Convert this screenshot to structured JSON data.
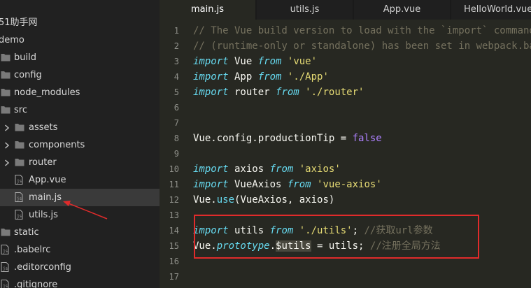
{
  "sidebar": {
    "project": "51助手网",
    "root": "demo",
    "items": [
      {
        "label": "build",
        "type": "folder",
        "expanded": false
      },
      {
        "label": "config",
        "type": "folder",
        "expanded": false
      },
      {
        "label": "node_modules",
        "type": "folder",
        "expanded": false
      },
      {
        "label": "src",
        "type": "folder",
        "expanded": true
      },
      {
        "label": "assets",
        "type": "folder",
        "expanded": false
      },
      {
        "label": "components",
        "type": "folder",
        "expanded": false
      },
      {
        "label": "router",
        "type": "folder",
        "expanded": false
      },
      {
        "label": "App.vue",
        "type": "file"
      },
      {
        "label": "main.js",
        "type": "file",
        "selected": true
      },
      {
        "label": "utils.js",
        "type": "file"
      },
      {
        "label": "static",
        "type": "folder",
        "expanded": false
      },
      {
        "label": ".babelrc",
        "type": "file"
      },
      {
        "label": ".editorconfig",
        "type": "file"
      },
      {
        "label": ".gitignore",
        "type": "file"
      }
    ]
  },
  "tabs": [
    {
      "label": "main.js",
      "active": true
    },
    {
      "label": "utils.js",
      "active": false
    },
    {
      "label": "App.vue",
      "active": false
    },
    {
      "label": "HelloWorld.vue",
      "active": false
    }
  ],
  "editor": {
    "line_numbers": [
      "1",
      "2",
      "3",
      "4",
      "5",
      "6",
      "7",
      "8",
      "9",
      "10",
      "11",
      "12",
      "13",
      "14",
      "15",
      "16",
      "17"
    ],
    "lines": [
      [
        {
          "t": "// The Vue build version to load with the `import` command",
          "c": "cm"
        }
      ],
      [
        {
          "t": "// (runtime-only or standalone) has been set in webpack.base.conf",
          "c": "cm"
        }
      ],
      [
        {
          "t": "import",
          "c": "kw"
        },
        {
          "t": " Vue "
        },
        {
          "t": "from",
          "c": "kw"
        },
        {
          "t": " "
        },
        {
          "t": "'vue'",
          "c": "str"
        }
      ],
      [
        {
          "t": "import",
          "c": "kw"
        },
        {
          "t": " App "
        },
        {
          "t": "from",
          "c": "kw"
        },
        {
          "t": " "
        },
        {
          "t": "'./App'",
          "c": "str"
        }
      ],
      [
        {
          "t": "import",
          "c": "kw"
        },
        {
          "t": " router "
        },
        {
          "t": "from",
          "c": "kw"
        },
        {
          "t": " "
        },
        {
          "t": "'./router'",
          "c": "str"
        }
      ],
      [],
      [],
      [
        {
          "t": "Vue.config.productionTip = "
        },
        {
          "t": "false",
          "c": "bool"
        }
      ],
      [],
      [
        {
          "t": "import",
          "c": "kw"
        },
        {
          "t": " axios "
        },
        {
          "t": "from",
          "c": "kw"
        },
        {
          "t": " "
        },
        {
          "t": "'axios'",
          "c": "str"
        }
      ],
      [
        {
          "t": "import",
          "c": "kw"
        },
        {
          "t": " VueAxios "
        },
        {
          "t": "from",
          "c": "kw"
        },
        {
          "t": " "
        },
        {
          "t": "'vue-axios'",
          "c": "str"
        }
      ],
      [
        {
          "t": "Vue."
        },
        {
          "t": "use",
          "c": "fn"
        },
        {
          "t": "(VueAxios, axios)"
        }
      ],
      [],
      [
        {
          "t": "import",
          "c": "kw"
        },
        {
          "t": " utils "
        },
        {
          "t": "from",
          "c": "kw"
        },
        {
          "t": " "
        },
        {
          "t": "'./utils'",
          "c": "str"
        },
        {
          "t": "; "
        },
        {
          "t": "//获取url参数",
          "c": "cm"
        }
      ],
      [
        {
          "t": "Vue."
        },
        {
          "t": "prototype",
          "c": "it"
        },
        {
          "t": "."
        },
        {
          "t": "$utils",
          "c": "hl"
        },
        {
          "t": " = utils; "
        },
        {
          "t": "//注册全局方法",
          "c": "cm"
        }
      ],
      [],
      []
    ]
  },
  "colors": {
    "annotation": "#e02b2b",
    "editor_bg": "#272822",
    "sidebar_bg": "#212121"
  }
}
